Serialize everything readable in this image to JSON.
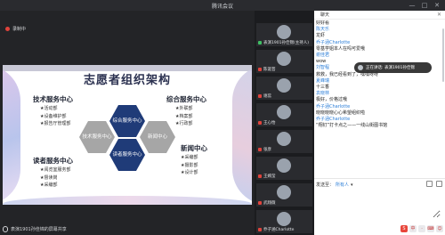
{
  "window": {
    "title": "腾讯会议",
    "controls": [
      "—",
      "□",
      "✕"
    ]
  },
  "stage": {
    "recording_label": "录制中",
    "bottom_name": "表演1901孙佳锦的屏幕共享"
  },
  "slide": {
    "title": "志愿者组织架构",
    "groups": [
      {
        "heading": "技术服务中心",
        "items": [
          "★活动部",
          "★设备维护部",
          "★报告厅管理部"
        ]
      },
      {
        "heading": "综合服务中心",
        "items": [
          "★外联部",
          "★档案部",
          "★行政部"
        ]
      },
      {
        "heading": "读者服务中心",
        "items": [
          "★阅览室服务部",
          "★督读岗",
          "★采编部"
        ]
      },
      {
        "heading": "新闻中心",
        "items": [
          "★采编部",
          "★摄影部",
          "★设计部"
        ]
      }
    ],
    "hexes": {
      "tech": "技术服务中心",
      "general": "综合服务中心",
      "reader": "读者服务中心",
      "news": "新闻中心"
    }
  },
  "participants": [
    {
      "name": "表演1901孙佳锦(主持人)",
      "mic": "on"
    },
    {
      "name": "陈诞芸",
      "mic": "off"
    },
    {
      "name": "谢蕊",
      "mic": "off"
    },
    {
      "name": "王心怡",
      "mic": "off"
    },
    {
      "name": "张彦",
      "mic": "off"
    },
    {
      "name": "王嫣莹",
      "mic": "off"
    },
    {
      "name": "武翔薇",
      "mic": "off"
    },
    {
      "name": "乔子涵Charlotte",
      "mic": "off"
    }
  ],
  "chat": {
    "header": "聊天",
    "messages": [
      {
        "kind": "t",
        "text": "好好看"
      },
      {
        "kind": "s",
        "text": "陈天乐"
      },
      {
        "kind": "t",
        "text": "龙虾"
      },
      {
        "kind": "s",
        "text": "乔子涵Charlotte"
      },
      {
        "kind": "t",
        "text": "零基学姐本人在吗可爱哦"
      },
      {
        "kind": "s",
        "text": "谢佳君"
      },
      {
        "kind": "t",
        "text": "wow"
      },
      {
        "kind": "s",
        "text": "刘智程"
      },
      {
        "kind": "t",
        "text": "救救，我已经看到了，嘿嘿呀呀"
      },
      {
        "kind": "s",
        "text": "夏峰瑞"
      },
      {
        "kind": "t",
        "text": "十三香"
      },
      {
        "kind": "s",
        "text": "袁晓林"
      },
      {
        "kind": "t",
        "text": "极好，价格过哦"
      },
      {
        "kind": "s",
        "text": "乔子涵Charlotte"
      },
      {
        "kind": "t",
        "text": "晓晓晓晓心心希望组织啦"
      },
      {
        "kind": "s",
        "text": "乔子涵Charlotte"
      },
      {
        "kind": "t",
        "text": "“翔钉”打卡点之——一线山街图书馆"
      }
    ],
    "toast": "正在讲话: 表演1901孙佳锦",
    "send_to_label": "发送至：",
    "send_to_value": "所有人",
    "input_placeholder": "",
    "ime_buttons": [
      "S",
      "中",
      "·",
      "⌨",
      "☺"
    ]
  }
}
